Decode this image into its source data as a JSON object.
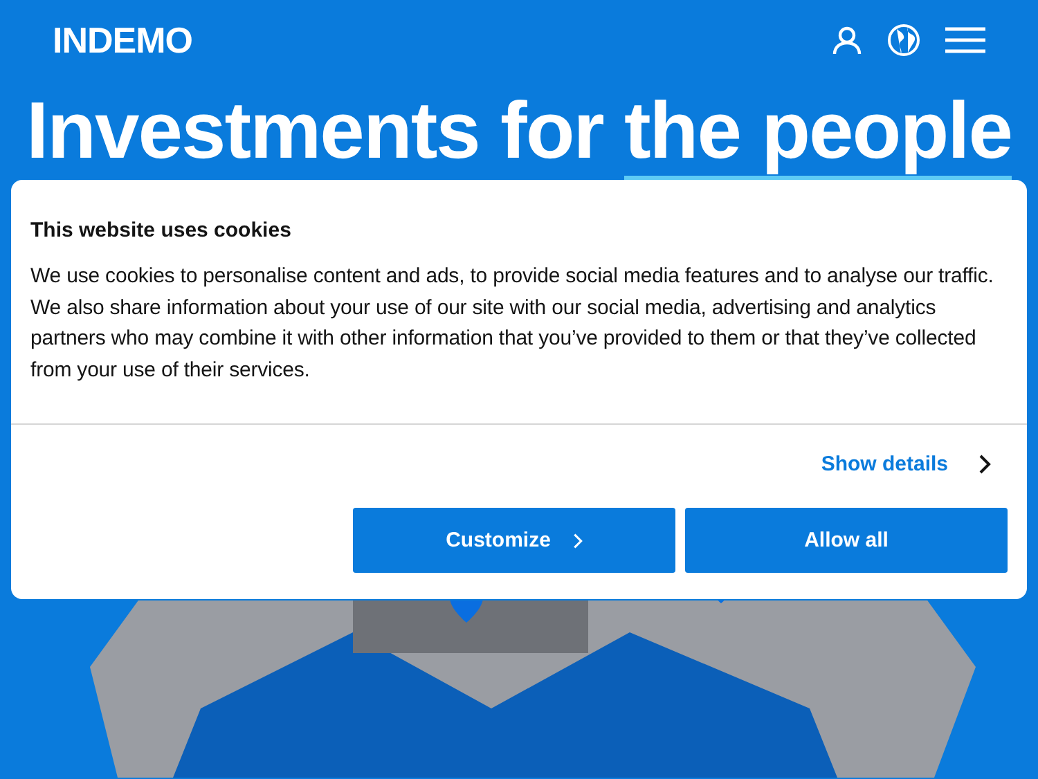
{
  "header": {
    "logo": "INDEMO"
  },
  "hero": {
    "title": "Investments for ",
    "title_highlight": "the people"
  },
  "cookie_dialog": {
    "title": "This website uses cookies",
    "body": "We use cookies to personalise content and ads, to provide social media features and to analyse our traffic. We also share information about your use of our site with our social media, advertising and analytics partners who may combine it with other information that you’ve provided to them or that they’ve collected from your use of their services.",
    "details_link": "Show details",
    "buttons": [
      {
        "label": "Customize",
        "kind": "chevron"
      },
      {
        "label": "Allow all",
        "kind": "plain"
      }
    ]
  }
}
